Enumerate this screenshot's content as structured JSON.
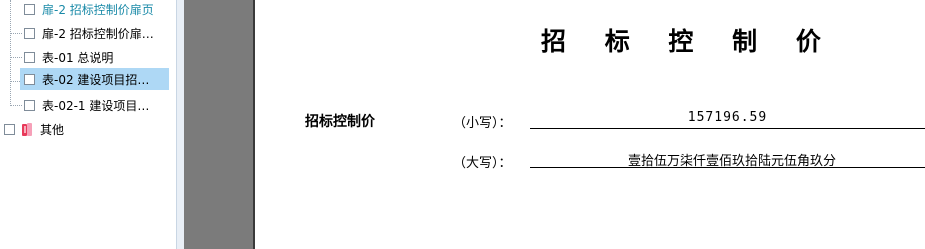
{
  "tree": {
    "items": [
      {
        "label": "扉-2 招标控制价扉页",
        "checked": false,
        "selected": false
      },
      {
        "label": "扉-2 招标控制价扉…",
        "checked": false,
        "selected": false
      },
      {
        "label": "表-01 总说明",
        "checked": false,
        "selected": false
      },
      {
        "label": "表-02 建设项目招…",
        "checked": false,
        "selected": true
      },
      {
        "label": "表-02-1 建设项目…",
        "checked": false,
        "selected": false
      },
      {
        "label": "其他",
        "checked": false,
        "selected": false
      }
    ]
  },
  "document": {
    "title": "招 标 控 制 价",
    "row_label": "招标控制价",
    "small": {
      "label": "（小写）：",
      "value": "157196.59"
    },
    "large": {
      "label": "（大写）：",
      "value": "壹拾伍万柒仟壹佰玖拾陆元伍角玖分"
    }
  },
  "colors": {
    "selected_bg": "#aed8f5",
    "link_teal": "#1a8aa8",
    "gutter": "#7b7b7b"
  }
}
